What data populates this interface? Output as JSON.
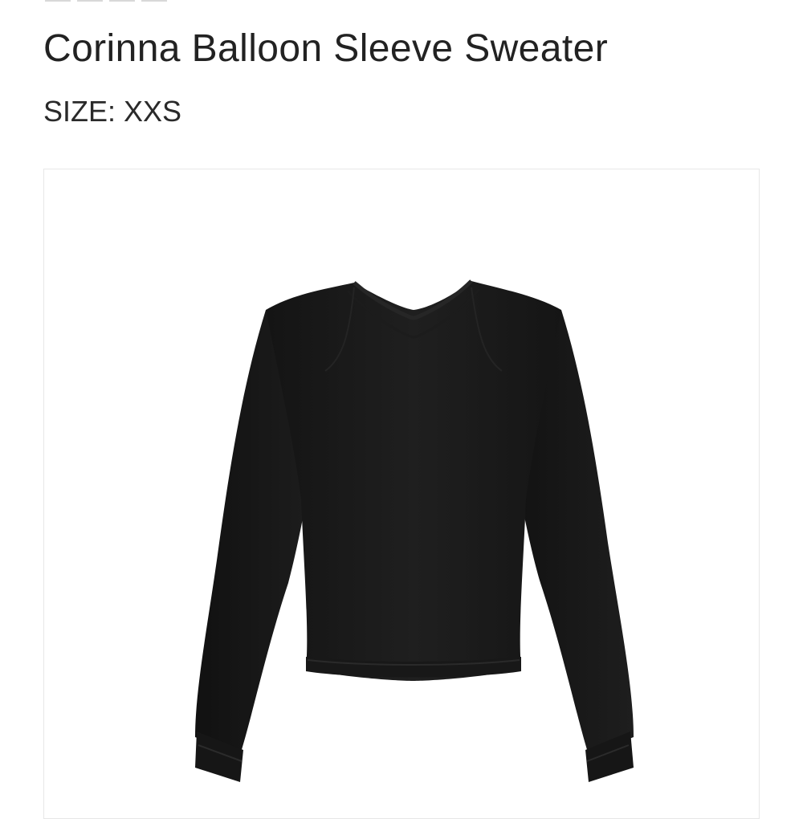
{
  "product": {
    "title": "Corinna Balloon Sleeve Sweater",
    "size_label": "SIZE:",
    "size_value": "XXS",
    "image_icon": "sweater-photo",
    "colors": {
      "garment": "#1b1b1b",
      "background": "#ffffff",
      "border": "#e7e7e7"
    }
  }
}
